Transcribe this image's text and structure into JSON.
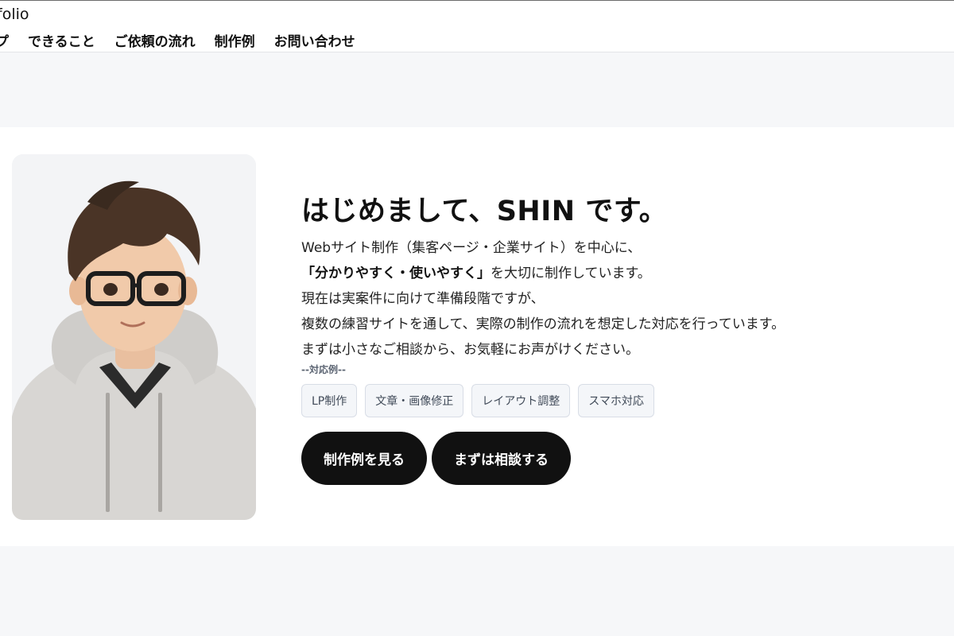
{
  "header": {
    "brand": "folio",
    "nav": [
      "プ",
      "できること",
      "ご依頼の流れ",
      "制作例",
      "お問い合わせ"
    ]
  },
  "hero": {
    "title": "はじめまして、SHIN です。",
    "lines": {
      "l1": "Webサイト制作（集客ページ・企業サイト）を中心に、",
      "l2_strong": "「分かりやすく・使いやすく」",
      "l2_rest": "を大切に制作しています。",
      "l3": "現在は実案件に向けて準備段階ですが、",
      "l4": "複数の練習サイトを通して、実際の制作の流れを想定した対応を行っています。",
      "l5": "まずは小さなご相談から、お気軽にお声がけください。"
    },
    "examples_label": "--対応例--",
    "tags": [
      "LP制作",
      "文章・画像修正",
      "レイアウト調整",
      "スマホ対応"
    ],
    "buttons": {
      "works": "制作例を見る",
      "consult": "まずは相談する"
    },
    "portrait": "illustrated-portrait-glasses-gray-hoodie"
  }
}
